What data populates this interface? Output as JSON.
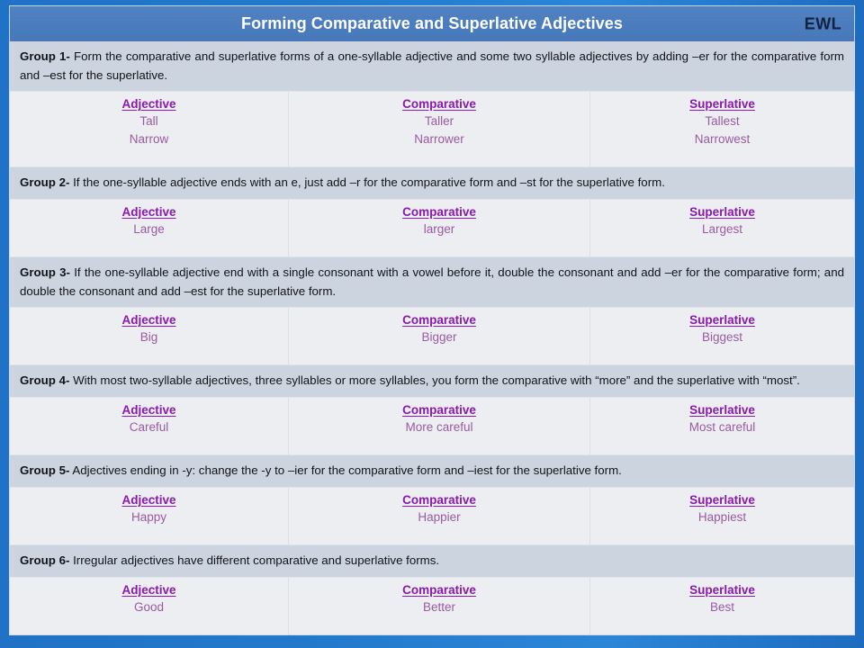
{
  "header": {
    "title": "Forming Comparative and Superlative Adjectives",
    "brand": "EWL"
  },
  "colors": {
    "frame_blue": "#2277cc",
    "titlebar_blue": "#4a7cbe",
    "desc_row_bg": "#ccd4e0",
    "data_row_bg": "#eceef1",
    "column_header_purple": "#8a19ad",
    "value_purple": "#9a5ba2",
    "brand_navy": "#13233f"
  },
  "columns": {
    "adjective": "Adjective",
    "comparative": "Comparative",
    "superlative": "Superlative"
  },
  "groups": [
    {
      "label": "Group 1-",
      "description": " Form the comparative and superlative forms of a one-syllable adjective and some two syllable adjectives by adding –er for the comparative form and –est for the superlative.",
      "adjectives": "Tall\nNarrow",
      "comparatives": "Taller\nNarrower",
      "superlatives": "Tallest\nNarrowest"
    },
    {
      "label": "Group 2-",
      "description": " If the one-syllable adjective ends with an e, just add –r for the comparative form and –st for the superlative form.",
      "adjectives": "Large",
      "comparatives": "larger",
      "superlatives": "Largest"
    },
    {
      "label": "Group 3-",
      "description": " If the one-syllable adjective end with a single consonant with a vowel before it, double the consonant and add –er for the comparative form; and double the consonant and add –est for the superlative form.",
      "adjectives": "Big",
      "comparatives": "Bigger",
      "superlatives": "Biggest"
    },
    {
      "label": "Group 4-",
      "description": " With most two-syllable adjectives, three syllables or more syllables, you form the comparative with “more” and the superlative with “most”.",
      "adjectives": "Careful",
      "comparatives": "More careful",
      "superlatives": "Most careful"
    },
    {
      "label": "Group 5-",
      "description": " Adjectives ending in -y: change the -y to –ier for the comparative form and –iest for the superlative form.",
      "adjectives": "Happy",
      "comparatives": "Happier",
      "superlatives": "Happiest"
    },
    {
      "label": "Group 6-",
      "description": " Irregular adjectives have different comparative and superlative forms.",
      "adjectives": "Good",
      "comparatives": "Better",
      "superlatives": "Best"
    }
  ]
}
